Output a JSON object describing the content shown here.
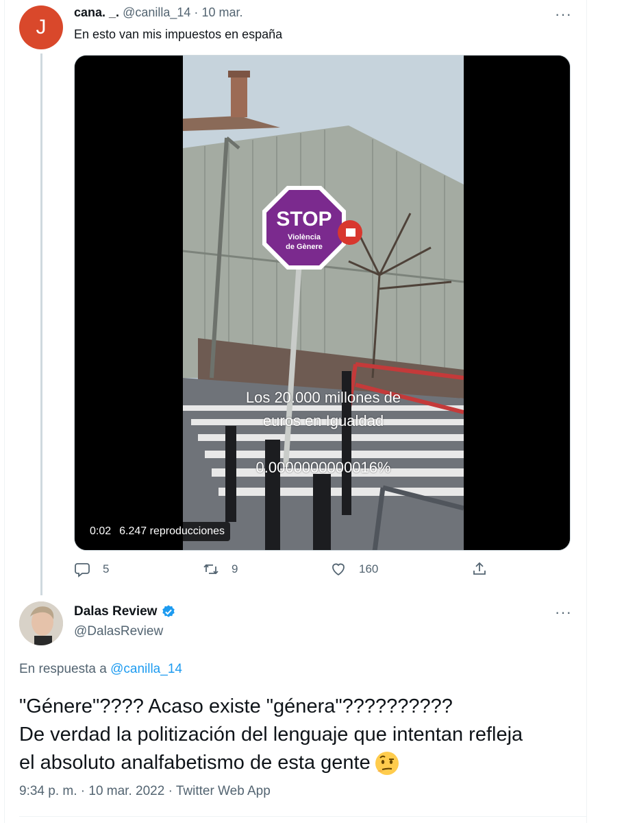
{
  "tweet1": {
    "avatar_letter": "J",
    "name": "cana. _.",
    "handle": "@canilla_14",
    "date": "10 mar.",
    "text": "En esto van mis impuestos en españa",
    "sign_text": "STOP",
    "sign_sub": "Violència de Gènere",
    "overlay_line1": "Los 20.000 millones de",
    "overlay_line2": "euros en Igualdad",
    "overlay_percent": "0.0000000000016%",
    "video_time": "0:02",
    "video_views": "6.247 reproducciones",
    "replies": "5",
    "retweets": "9",
    "likes": "160",
    "more": "···"
  },
  "tweet2": {
    "name": "Dalas Review",
    "handle": "@DalasReview",
    "reply_prefix": "En respuesta a",
    "reply_to": "@canilla_14",
    "line1": "\"Génere\"???? Acaso existe \"génera\"??????????",
    "line2": "De verdad la politización del lenguaje que intentan refleja",
    "line3": "el absoluto analfabetismo de esta gente",
    "emoji": "face-with-raised-eyebrow",
    "meta": "9:34 p. m. · 10 mar. 2022 · Twitter Web App",
    "more": "···"
  },
  "colors": {
    "accent": "#1d9bf0",
    "sign_purple": "#7b2a8e",
    "avatar_bg": "#d9482b",
    "muted": "#536471"
  }
}
